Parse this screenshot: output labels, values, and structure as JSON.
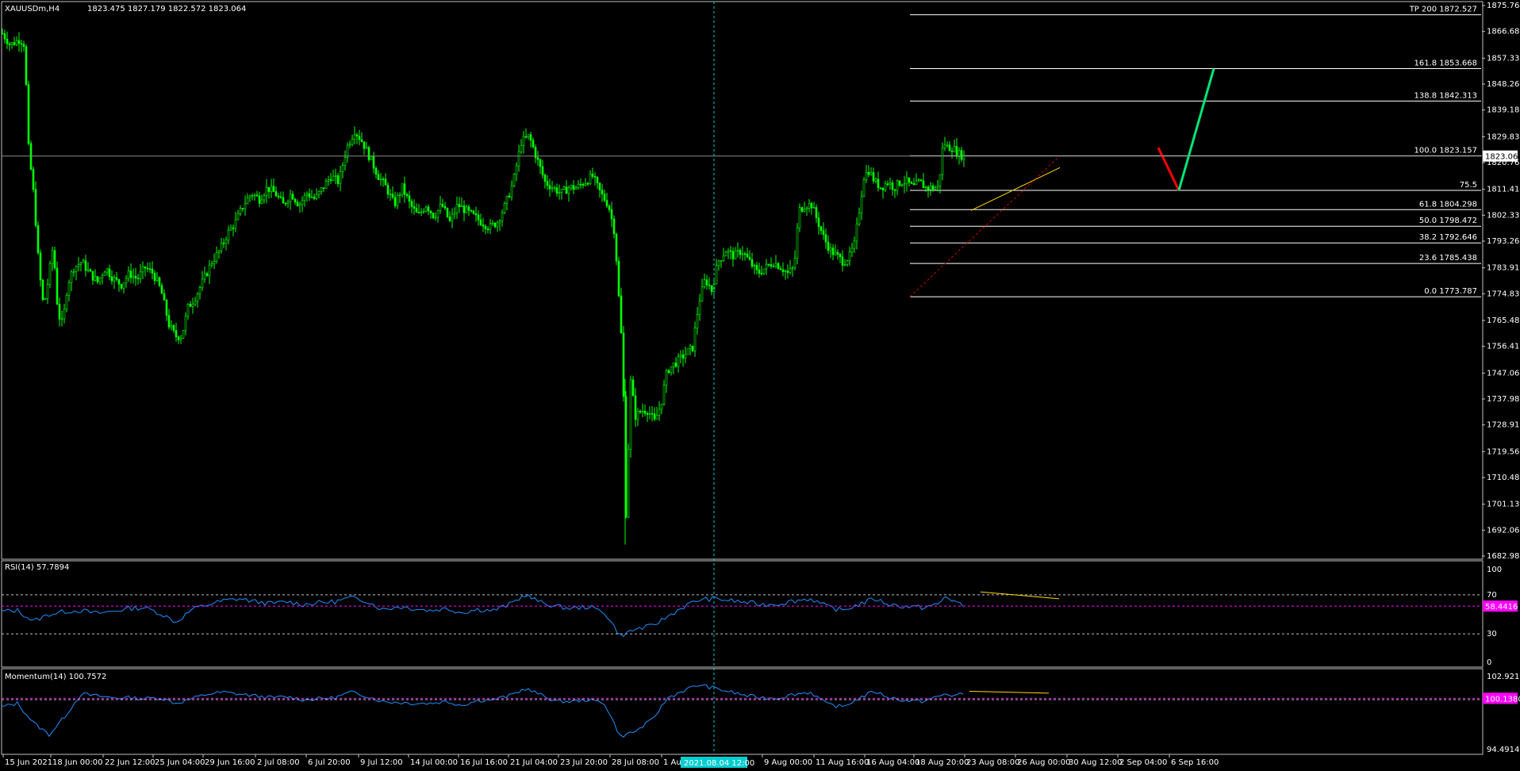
{
  "window": {
    "symbol_title": "XAUUSDm,H4",
    "ohlc": "1823.475 1827.179 1822.572 1823.064"
  },
  "colors": {
    "background": "#000000",
    "candle": "#00ff00",
    "grid_frame": "#c0c0c0",
    "fib_lines": "#ffffff",
    "indicator_line": "#1e90ff",
    "level_magenta": "#ff00ff",
    "forecast_down": "#ff0000",
    "forecast_up": "#00e676",
    "trendline": "#ffd700",
    "crosshair": "#00ced1"
  },
  "chart_data": [
    {
      "type": "candlestick",
      "name": "main-price",
      "y_ticks": [
        "1875.760",
        "1866.685",
        "1857.335",
        "1848.260",
        "1839.185",
        "1829.835",
        "1820.760",
        "1811.410",
        "1802.335",
        "1793.260",
        "1783.910",
        "1774.835",
        "1765.485",
        "1756.410",
        "1747.060",
        "1737.985",
        "1728.910",
        "1719.560",
        "1710.485",
        "1701.135",
        "1692.060",
        "1682.985"
      ],
      "ylim": [
        1682.985,
        1875.76
      ],
      "current_price": "1823.064",
      "x_ticks": [
        "15 Jun 2021",
        "18 Jun 00:00",
        "22 Jun 12:00",
        "25 Jun 04:00",
        "29 Jun 16:00",
        "2 Jul 08:00",
        "6 Jul 20:00",
        "9 Jul 12:00",
        "14 Jul 00:00",
        "16 Jul 16:00",
        "21 Jul 04:00",
        "23 Jul 20:00",
        "28 Jul 08:00",
        "1 Aug",
        "9 Aug 00:00",
        "11 Aug 16:00",
        "16 Aug 04:00",
        "18 Aug 20:00",
        "23 Aug 08:00",
        "26 Aug 00:00",
        "30 Aug 12:00",
        "2 Sep 04:00",
        "6 Sep 16:00"
      ],
      "crosshair_label": "2021.08.04 12:00",
      "fibonacci": [
        {
          "label": "TP 200 1872.527",
          "price": 1872.527
        },
        {
          "label": "161.8 1853.668",
          "price": 1853.668
        },
        {
          "label": "138.8 1842.313",
          "price": 1842.313
        },
        {
          "label": "100.0 1823.157",
          "price": 1823.157
        },
        {
          "label": "75.5",
          "price": 1811.05
        },
        {
          "label": "61.8 1804.298",
          "price": 1804.298
        },
        {
          "label": "50.0 1798.472",
          "price": 1798.472
        },
        {
          "label": "38.2 1792.646",
          "price": 1792.646
        },
        {
          "label": "23.6 1785.438",
          "price": 1785.438
        },
        {
          "label": "0.0 1773.787",
          "price": 1773.787
        }
      ],
      "price_path": [
        [
          0,
          1866
        ],
        [
          10,
          1862
        ],
        [
          22,
          1864
        ],
        [
          28,
          1862
        ],
        [
          33,
          1826
        ],
        [
          40,
          1808
        ],
        [
          46,
          1784
        ],
        [
          52,
          1770
        ],
        [
          58,
          1780
        ],
        [
          64,
          1792
        ],
        [
          70,
          1768
        ],
        [
          76,
          1764
        ],
        [
          82,
          1778
        ],
        [
          90,
          1784
        ],
        [
          100,
          1786
        ],
        [
          110,
          1782
        ],
        [
          120,
          1779
        ],
        [
          130,
          1784
        ],
        [
          140,
          1780
        ],
        [
          150,
          1778
        ],
        [
          160,
          1782
        ],
        [
          170,
          1780
        ],
        [
          180,
          1784
        ],
        [
          190,
          1782
        ],
        [
          200,
          1776
        ],
        [
          210,
          1764
        ],
        [
          218,
          1760
        ],
        [
          226,
          1760
        ],
        [
          234,
          1770
        ],
        [
          244,
          1774
        ],
        [
          254,
          1780
        ],
        [
          264,
          1786
        ],
        [
          274,
          1790
        ],
        [
          284,
          1796
        ],
        [
          294,
          1800
        ],
        [
          304,
          1806
        ],
        [
          314,
          1810
        ],
        [
          324,
          1808
        ],
        [
          334,
          1812
        ],
        [
          344,
          1810
        ],
        [
          354,
          1806
        ],
        [
          364,
          1810
        ],
        [
          374,
          1806
        ],
        [
          384,
          1810
        ],
        [
          394,
          1808
        ],
        [
          404,
          1812
        ],
        [
          414,
          1816
        ],
        [
          424,
          1814
        ],
        [
          434,
          1826
        ],
        [
          444,
          1832
        ],
        [
          454,
          1828
        ],
        [
          464,
          1822
        ],
        [
          474,
          1816
        ],
        [
          484,
          1812
        ],
        [
          494,
          1806
        ],
        [
          504,
          1812
        ],
        [
          514,
          1806
        ],
        [
          524,
          1802
        ],
        [
          534,
          1806
        ],
        [
          544,
          1802
        ],
        [
          554,
          1806
        ],
        [
          564,
          1800
        ],
        [
          574,
          1806
        ],
        [
          584,
          1804
        ],
        [
          594,
          1802
        ],
        [
          604,
          1800
        ],
        [
          614,
          1798
        ],
        [
          624,
          1800
        ],
        [
          634,
          1806
        ],
        [
          644,
          1814
        ],
        [
          654,
          1828
        ],
        [
          664,
          1830
        ],
        [
          674,
          1822
        ],
        [
          684,
          1814
        ],
        [
          694,
          1812
        ],
        [
          704,
          1810
        ],
        [
          714,
          1812
        ],
        [
          724,
          1812
        ],
        [
          734,
          1814
        ],
        [
          744,
          1816
        ],
        [
          754,
          1810
        ],
        [
          764,
          1806
        ],
        [
          772,
          1796
        ],
        [
          776,
          1778
        ],
        [
          782,
          1752
        ],
        [
          786,
          1698
        ],
        [
          792,
          1744
        ],
        [
          798,
          1732
        ],
        [
          806,
          1734
        ],
        [
          814,
          1734
        ],
        [
          822,
          1730
        ],
        [
          830,
          1736
        ],
        [
          838,
          1748
        ],
        [
          846,
          1750
        ],
        [
          854,
          1752
        ],
        [
          862,
          1754
        ],
        [
          870,
          1756
        ],
        [
          878,
          1772
        ],
        [
          886,
          1780
        ],
        [
          894,
          1776
        ],
        [
          902,
          1786
        ],
        [
          912,
          1790
        ],
        [
          922,
          1788
        ],
        [
          932,
          1790
        ],
        [
          942,
          1786
        ],
        [
          952,
          1782
        ],
        [
          962,
          1784
        ],
        [
          972,
          1786
        ],
        [
          982,
          1784
        ],
        [
          990,
          1782
        ],
        [
          998,
          1784
        ],
        [
          1004,
          1804
        ],
        [
          1012,
          1806
        ],
        [
          1020,
          1806
        ],
        [
          1028,
          1800
        ],
        [
          1036,
          1794
        ],
        [
          1044,
          1790
        ],
        [
          1052,
          1788
        ],
        [
          1060,
          1786
        ],
        [
          1068,
          1788
        ],
        [
          1074,
          1792
        ],
        [
          1080,
          1804
        ],
        [
          1086,
          1816
        ],
        [
          1092,
          1818
        ],
        [
          1100,
          1814
        ],
        [
          1108,
          1812
        ],
        [
          1116,
          1814
        ],
        [
          1124,
          1812
        ],
        [
          1132,
          1814
        ],
        [
          1140,
          1814
        ],
        [
          1148,
          1812
        ],
        [
          1156,
          1814
        ],
        [
          1164,
          1812
        ],
        [
          1172,
          1812
        ],
        [
          1180,
          1812
        ],
        [
          1186,
          1828
        ],
        [
          1192,
          1826
        ],
        [
          1198,
          1826
        ],
        [
          1204,
          1824
        ],
        [
          1212,
          1823
        ]
      ],
      "forecast": [
        {
          "from": [
            1200,
            1826
          ],
          "to": [
            1226,
            1811.05
          ],
          "direction": "down"
        },
        {
          "from": [
            1226,
            1811.05
          ],
          "to": [
            1270,
            1853.668
          ],
          "direction": "up"
        }
      ],
      "trendline": [
        [
          1002,
          1804
        ],
        [
          1092,
          1819
        ]
      ]
    },
    {
      "type": "line",
      "name": "RSI(14)",
      "title": "RSI(14) 57.7894",
      "ylim": [
        0,
        100
      ],
      "y_ticks": [
        "100",
        "70",
        "30",
        "0"
      ],
      "levels": [
        70,
        30
      ],
      "current_value": "58.4416",
      "values": [
        [
          0,
          53
        ],
        [
          20,
          54
        ],
        [
          40,
          43
        ],
        [
          60,
          50
        ],
        [
          80,
          53
        ],
        [
          100,
          54
        ],
        [
          120,
          51
        ],
        [
          140,
          53
        ],
        [
          160,
          56
        ],
        [
          180,
          57
        ],
        [
          200,
          51
        ],
        [
          220,
          42
        ],
        [
          240,
          55
        ],
        [
          260,
          60
        ],
        [
          280,
          64
        ],
        [
          300,
          66
        ],
        [
          320,
          63
        ],
        [
          340,
          61
        ],
        [
          360,
          63
        ],
        [
          380,
          60
        ],
        [
          400,
          62
        ],
        [
          420,
          63
        ],
        [
          440,
          67
        ],
        [
          460,
          64
        ],
        [
          480,
          55
        ],
        [
          500,
          58
        ],
        [
          520,
          56
        ],
        [
          540,
          54
        ],
        [
          560,
          56
        ],
        [
          580,
          52
        ],
        [
          600,
          55
        ],
        [
          620,
          54
        ],
        [
          640,
          60
        ],
        [
          660,
          70
        ],
        [
          680,
          62
        ],
        [
          700,
          58
        ],
        [
          720,
          56
        ],
        [
          740,
          58
        ],
        [
          760,
          52
        ],
        [
          780,
          28
        ],
        [
          800,
          35
        ],
        [
          820,
          38
        ],
        [
          840,
          48
        ],
        [
          860,
          58
        ],
        [
          880,
          65
        ],
        [
          900,
          66
        ],
        [
          920,
          64
        ],
        [
          940,
          62
        ],
        [
          960,
          60
        ],
        [
          980,
          61
        ],
        [
          1000,
          64
        ],
        [
          1020,
          66
        ],
        [
          1040,
          58
        ],
        [
          1060,
          54
        ],
        [
          1080,
          60
        ],
        [
          1100,
          66
        ],
        [
          1120,
          60
        ],
        [
          1140,
          58
        ],
        [
          1160,
          57
        ],
        [
          1180,
          60
        ],
        [
          1190,
          68
        ],
        [
          1200,
          64
        ],
        [
          1212,
          58
        ]
      ]
    },
    {
      "type": "line",
      "name": "Momentum(14)",
      "title": "Momentum(14) 100.7572",
      "ylim": [
        94.4914,
        102.9215
      ],
      "y_ticks": [
        "102.9215",
        "94.4914"
      ],
      "levels": [
        100
      ],
      "current_value": "100.1380",
      "values": [
        [
          0,
          99.2
        ],
        [
          20,
          99.6
        ],
        [
          40,
          97.5
        ],
        [
          60,
          96.2
        ],
        [
          80,
          98.2
        ],
        [
          100,
          100.6
        ],
        [
          120,
          100.4
        ],
        [
          140,
          100.2
        ],
        [
          160,
          100.2
        ],
        [
          180,
          100.1
        ],
        [
          200,
          100.2
        ],
        [
          220,
          99.6
        ],
        [
          240,
          100.1
        ],
        [
          260,
          100.6
        ],
        [
          280,
          100.8
        ],
        [
          300,
          100.6
        ],
        [
          320,
          100.4
        ],
        [
          340,
          100.2
        ],
        [
          360,
          100.3
        ],
        [
          380,
          100.0
        ],
        [
          400,
          100.1
        ],
        [
          420,
          100.2
        ],
        [
          440,
          100.8
        ],
        [
          460,
          100.4
        ],
        [
          480,
          99.8
        ],
        [
          500,
          99.7
        ],
        [
          520,
          99.6
        ],
        [
          540,
          99.6
        ],
        [
          560,
          99.8
        ],
        [
          580,
          99.4
        ],
        [
          600,
          99.9
        ],
        [
          620,
          100.0
        ],
        [
          640,
          100.4
        ],
        [
          660,
          101.2
        ],
        [
          680,
          100.5
        ],
        [
          700,
          99.8
        ],
        [
          720,
          99.8
        ],
        [
          740,
          100.0
        ],
        [
          760,
          99.6
        ],
        [
          780,
          96.0
        ],
        [
          800,
          96.6
        ],
        [
          820,
          97.8
        ],
        [
          840,
          100.2
        ],
        [
          860,
          101.0
        ],
        [
          880,
          101.6
        ],
        [
          900,
          101.2
        ],
        [
          920,
          100.8
        ],
        [
          940,
          100.4
        ],
        [
          960,
          100.2
        ],
        [
          980,
          100.2
        ],
        [
          1000,
          100.6
        ],
        [
          1020,
          100.8
        ],
        [
          1040,
          99.5
        ],
        [
          1060,
          99.2
        ],
        [
          1080,
          100.1
        ],
        [
          1100,
          100.9
        ],
        [
          1120,
          100.2
        ],
        [
          1140,
          99.9
        ],
        [
          1160,
          99.8
        ],
        [
          1180,
          100.3
        ],
        [
          1190,
          100.6
        ],
        [
          1200,
          100.4
        ],
        [
          1212,
          100.6
        ]
      ],
      "trendline": [
        [
          1000,
          100.9
        ],
        [
          1090,
          100.7
        ]
      ]
    }
  ]
}
